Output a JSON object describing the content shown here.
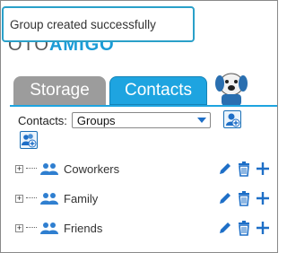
{
  "toast": {
    "message": "Group created successfully"
  },
  "logo": {
    "prefix": "OTO",
    "name": "AMIGO"
  },
  "tabs": [
    {
      "label": "Storage",
      "active": false
    },
    {
      "label": "Contacts",
      "active": true
    }
  ],
  "contacts": {
    "label": "Contacts:",
    "selected": "Groups"
  },
  "groups": [
    {
      "name": "Coworkers"
    },
    {
      "name": "Family"
    },
    {
      "name": "Friends"
    }
  ],
  "colors": {
    "accent": "#1ea4e0",
    "tab_inactive": "#9c9c9c",
    "icon_blue": "#1e6fc7"
  },
  "icons": [
    "add-contact-icon",
    "add-group-icon",
    "expand-icon",
    "people-icon",
    "edit-icon",
    "trash-icon",
    "plus-icon",
    "caret-down-icon"
  ]
}
